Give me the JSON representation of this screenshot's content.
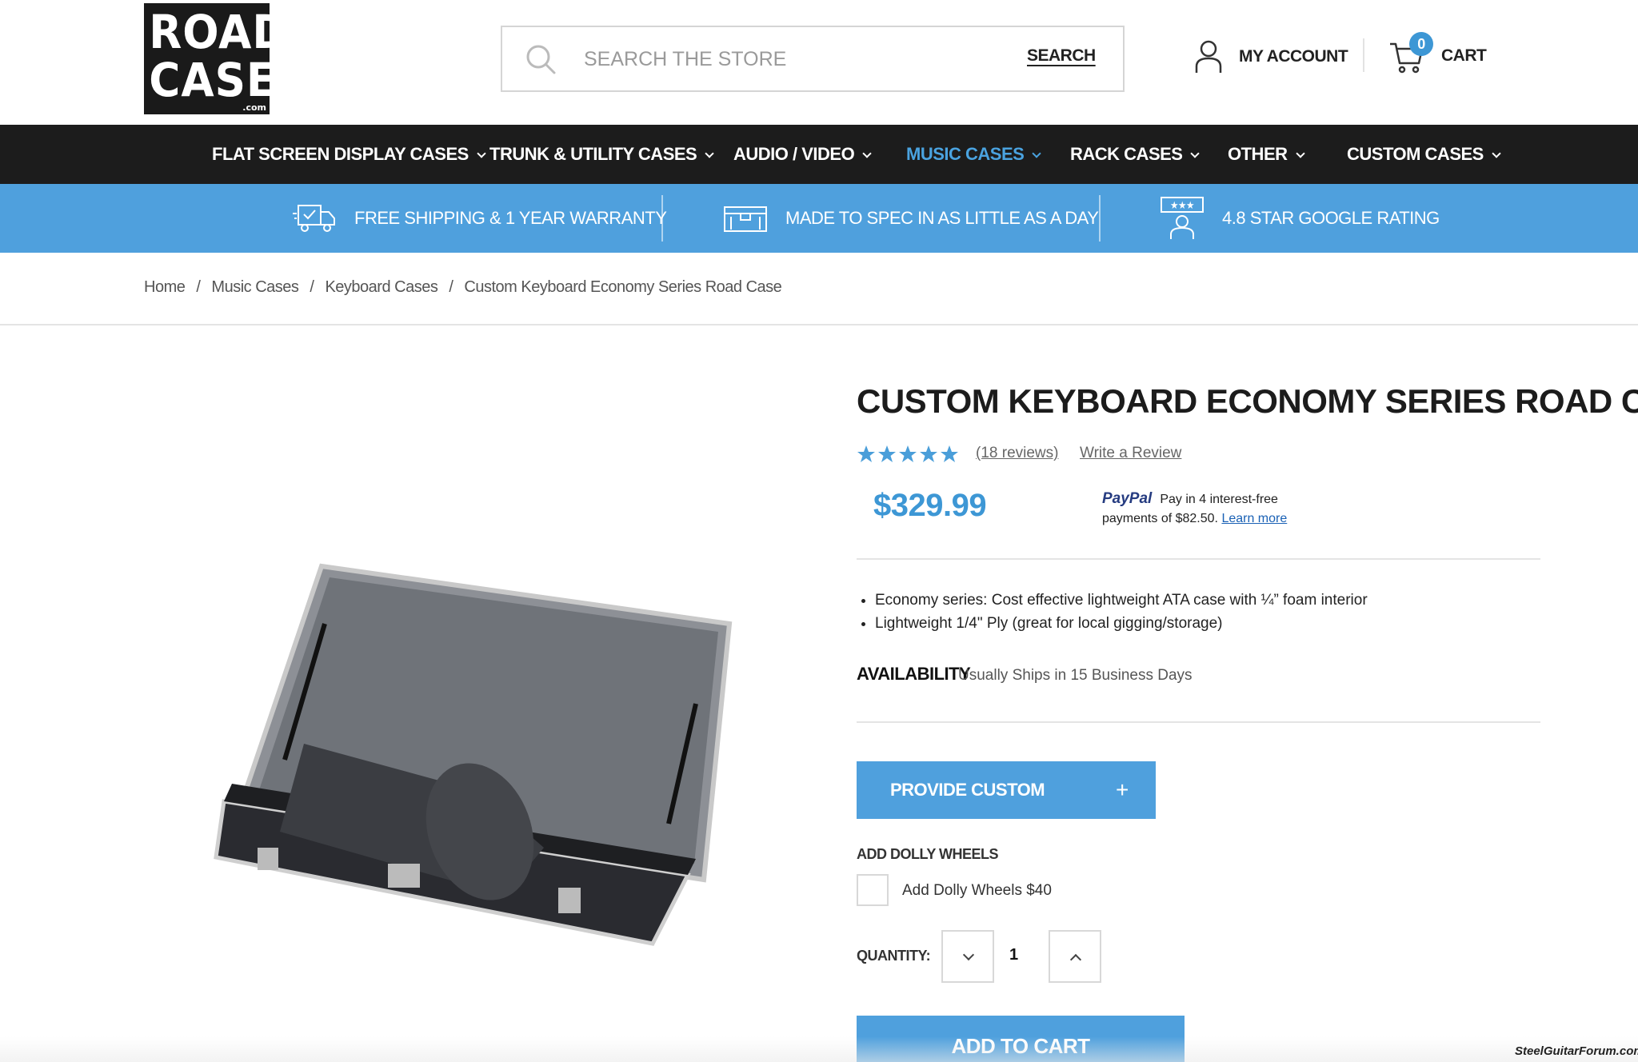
{
  "brand": {
    "logo_line1": "ROAD",
    "logo_line2": "CASES",
    "logo_suffix": ".com"
  },
  "search": {
    "placeholder": "SEARCH THE STORE",
    "button_label": "SEARCH"
  },
  "account": {
    "label": "MY ACCOUNT"
  },
  "cart": {
    "label": "CART",
    "count": "0"
  },
  "nav": {
    "items": [
      {
        "label": "FLAT SCREEN DISPLAY CASES"
      },
      {
        "label": "TRUNK & UTILITY CASES"
      },
      {
        "label": "AUDIO / VIDEO"
      },
      {
        "label": "MUSIC CASES",
        "active": true
      },
      {
        "label": "RACK CASES"
      },
      {
        "label": "OTHER"
      },
      {
        "label": "CUSTOM CASES"
      }
    ]
  },
  "perks": [
    {
      "icon": "truck-icon",
      "label": "FREE SHIPPING & 1 YEAR WARRANTY"
    },
    {
      "icon": "case-icon",
      "label": "MADE TO SPEC IN AS LITTLE AS A DAY"
    },
    {
      "icon": "rating-icon",
      "label": "4.8 STAR GOOGLE RATING"
    }
  ],
  "breadcrumb": [
    "Home",
    "Music Cases",
    "Keyboard Cases",
    "Custom Keyboard Economy Series Road Case"
  ],
  "product": {
    "title": "CUSTOM KEYBOARD ECONOMY SERIES ROAD CASE",
    "rating": 5,
    "reviews_label": "(18 reviews)",
    "write_review_label": "Write a Review",
    "price": "$329.99",
    "paypal": {
      "brand": "PayPal",
      "text_line1": "Pay in 4 interest-free",
      "text_line2": "payments of $82.50.",
      "learn_more": "Learn more"
    },
    "bullets": [
      "Economy series: Cost effective lightweight ATA case with ¼” foam interior",
      "Lightweight 1/4\" Ply (great for local gigging/storage)"
    ],
    "availability_label": "AVAILABILITY",
    "availability_value": "Usually Ships in 15 Business Days",
    "custom_dims_label": "PROVIDE CUSTOM DIMENSIONS",
    "custom_dims_icon": "+",
    "dolly_section_label": "ADD DOLLY WHEELS",
    "dolly_option_label": "Add Dolly Wheels $40",
    "dolly_checked": false,
    "quantity_label": "QUANTITY:",
    "quantity": "1",
    "add_to_cart_label": "ADD TO CART"
  },
  "watermark": "SteelGuitarForum.com",
  "colors": {
    "accent": "#4fa0dd",
    "nav_bg": "#1c1c1c",
    "price": "#3d97d5"
  }
}
